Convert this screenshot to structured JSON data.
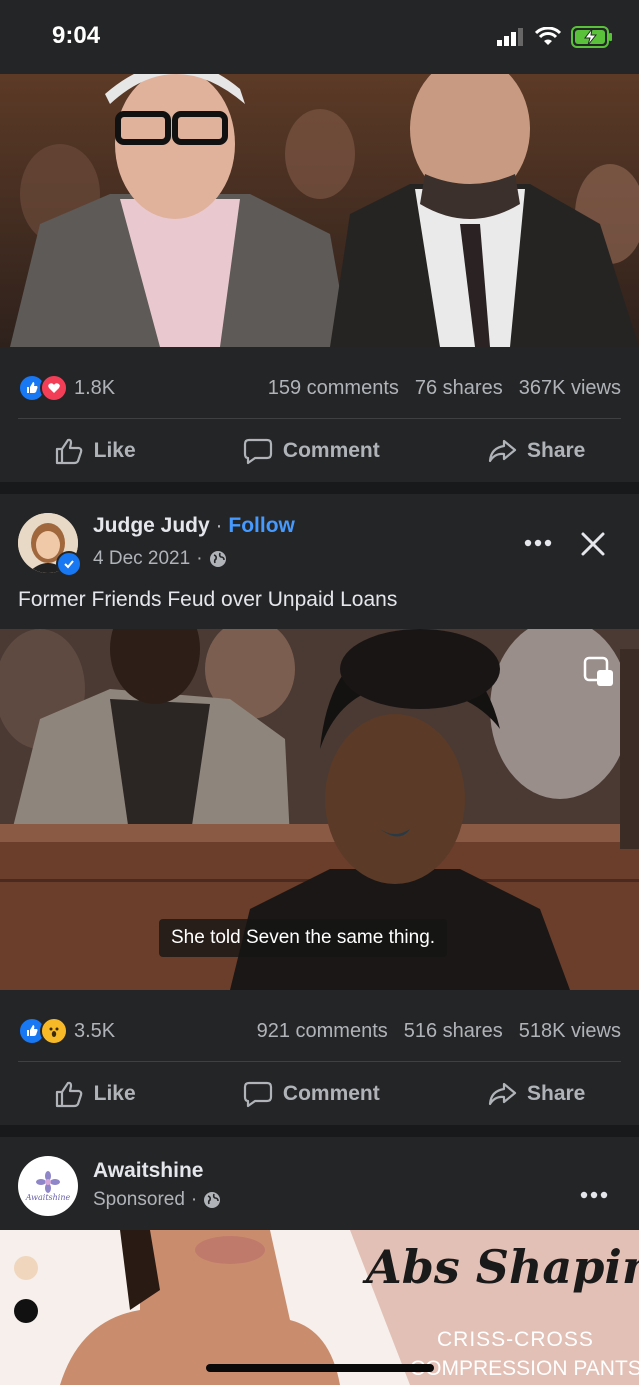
{
  "status": {
    "time": "9:04"
  },
  "post1": {
    "reactions_count": "1.8K",
    "comments": "159 comments",
    "shares": "76 shares",
    "views": "367K views"
  },
  "post2": {
    "author": "Judge Judy",
    "follow_label": "Follow",
    "separator": "·",
    "date": "4 Dec 2021",
    "text": "Former Friends Feud over Unpaid Loans",
    "subtitle": "She told Seven the same thing.",
    "reactions_count": "3.5K",
    "comments": "921 comments",
    "shares": "516 shares",
    "views": "518K views"
  },
  "post3": {
    "author": "Awaitshine",
    "avatar_text": "Awaitshine",
    "sponsored": "Sponsored",
    "ad_title": "Abs Shaping",
    "ad_sub1": "CRISS-CROSS",
    "ad_sub2": "COMPRESSION PANTS"
  },
  "actions": {
    "like": "Like",
    "comment": "Comment",
    "share": "Share"
  },
  "colors": {
    "background": "#18191a",
    "card": "#242526",
    "accent": "#4599ff",
    "text_secondary": "#b0b3b8"
  }
}
